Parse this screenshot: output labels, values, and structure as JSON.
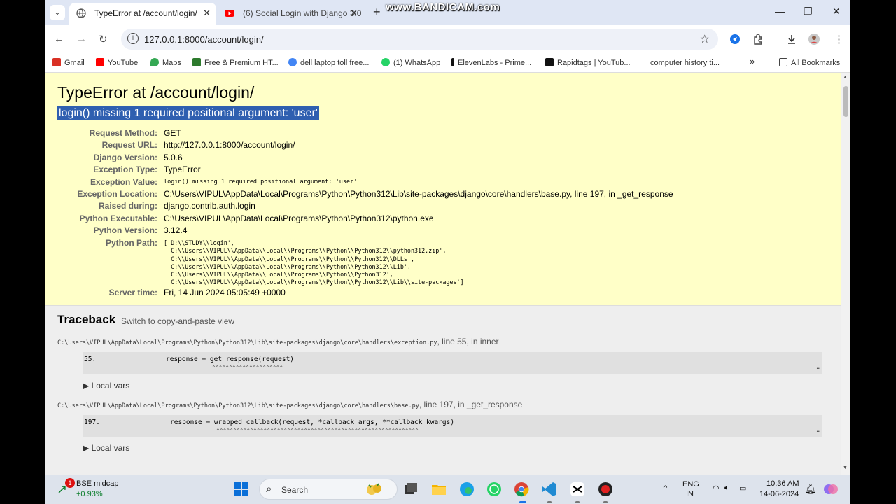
{
  "window": {
    "tab_active_title": "TypeError at /account/login/",
    "tab_inactive_title": "(6) Social Login with Django 3.0",
    "watermark": "www.BANDICAM.com",
    "minimize_glyph": "—",
    "restore_glyph": "❐",
    "close_glyph": "✕"
  },
  "navbar": {
    "url": "127.0.0.1:8000/account/login/"
  },
  "bookmarks": {
    "items": [
      {
        "label": "Gmail",
        "color": "#d93025"
      },
      {
        "label": "YouTube",
        "color": "#ff0000"
      },
      {
        "label": "Maps",
        "color": "#34a853"
      },
      {
        "label": "Free & Premium HT...",
        "color": "#2d7a2d"
      },
      {
        "label": "dell laptop toll free...",
        "color": "#4285f4"
      },
      {
        "label": "(1) WhatsApp",
        "color": "#25d366"
      },
      {
        "label": "ElevenLabs - Prime...",
        "color": "#111111"
      },
      {
        "label": "Rapidtags | YouTub...",
        "color": "#111111"
      },
      {
        "label": "computer history ti...",
        "color": "#ffffff"
      }
    ],
    "all_bookmarks": "All Bookmarks"
  },
  "error": {
    "title": "TypeError at /account/login/",
    "exception_value_heading": "login() missing 1 required positional argument: 'user'",
    "meta": [
      {
        "key": "Request Method:",
        "value": "GET"
      },
      {
        "key": "Request URL:",
        "value": "http://127.0.0.1:8000/account/login/"
      },
      {
        "key": "Django Version:",
        "value": "5.0.6"
      },
      {
        "key": "Exception Type:",
        "value": "TypeError"
      },
      {
        "key": "Exception Value:",
        "value": "login() missing 1 required positional argument: 'user'"
      },
      {
        "key": "Exception Location:",
        "value": "C:\\Users\\VIPUL\\AppData\\Local\\Programs\\Python\\Python312\\Lib\\site-packages\\django\\core\\handlers\\base.py, line 197, in _get_response"
      },
      {
        "key": "Raised during:",
        "value": "django.contrib.auth.login"
      },
      {
        "key": "Python Executable:",
        "value": "C:\\Users\\VIPUL\\AppData\\Local\\Programs\\Python\\Python312\\python.exe"
      },
      {
        "key": "Python Version:",
        "value": "3.12.4"
      },
      {
        "key": "Python Path:",
        "value": ""
      }
    ],
    "python_path_lines": [
      "['D:\\\\STUDY\\\\login',",
      " 'C:\\\\Users\\\\VIPUL\\\\AppData\\\\Local\\\\Programs\\\\Python\\\\Python312\\\\python312.zip',",
      " 'C:\\\\Users\\\\VIPUL\\\\AppData\\\\Local\\\\Programs\\\\Python\\\\Python312\\\\DLLs',",
      " 'C:\\\\Users\\\\VIPUL\\\\AppData\\\\Local\\\\Programs\\\\Python\\\\Python312\\\\Lib',",
      " 'C:\\\\Users\\\\VIPUL\\\\AppData\\\\Local\\\\Programs\\\\Python\\\\Python312',",
      " 'C:\\\\Users\\\\VIPUL\\\\AppData\\\\Local\\\\Programs\\\\Python\\\\Python312\\\\Lib\\\\site-packages']"
    ],
    "server_time_key": "Server time:",
    "server_time_value": "Fri, 14 Jun 2024 05:05:49 +0000"
  },
  "traceback": {
    "heading": "Traceback",
    "switch_link": "Switch to copy-and-paste view",
    "frames": [
      {
        "file": "C:\\Users\\VIPUL\\AppData\\Local\\Programs\\Python\\Python312\\Lib\\site-packages\\django\\core\\handlers\\exception.py",
        "location": ", line 55, in inner",
        "line_no": "55.",
        "code": "response = get_response(request)",
        "caret": "^^^^^^^^^^^^^^^^^^^^^",
        "local_vars": "Local vars"
      },
      {
        "file": "C:\\Users\\VIPUL\\AppData\\Local\\Programs\\Python\\Python312\\Lib\\site-packages\\django\\core\\handlers\\base.py",
        "location": ", line 197, in _get_response",
        "line_no": "197.",
        "code": "response = wrapped_callback(request, *callback_args, **callback_kwargs)",
        "caret": "^^^^^^^^^^^^^^^^^^^^^^^^^^^^^^^^^^^^^^^^^^^^^^^^^^^^^^^^^^^^",
        "local_vars": "Local vars"
      }
    ],
    "ellipsis": "…"
  },
  "taskbar": {
    "widget_badge": "1",
    "widget_title": "BSE midcap",
    "widget_value": "+0.93%",
    "search_label": "Search",
    "lang_line1": "ENG",
    "lang_line2": "IN",
    "time": "10:36 AM",
    "date": "14-06-2024"
  },
  "colors": {
    "summary_bg": "#ffffc8",
    "selection": "#2f5fb0",
    "tabbar_bg": "#dfe6f4",
    "taskbar_bg": "#dde3ec"
  }
}
